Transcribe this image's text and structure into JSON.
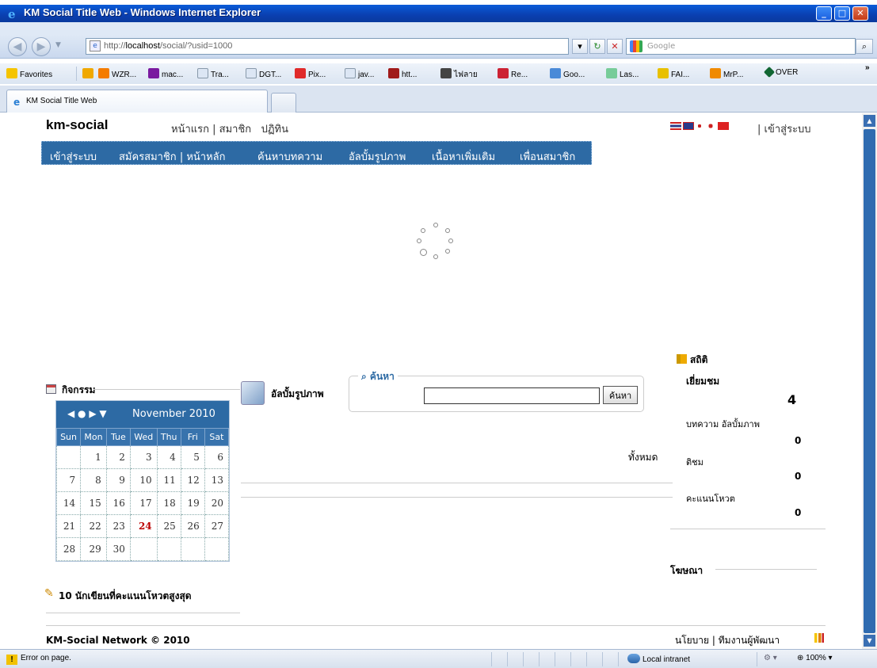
{
  "window": {
    "title": "KM Social Title Web - Windows Internet Explorer",
    "url_prefix": "http://",
    "url_host": "localhost",
    "url_path": "/social/?usid=1000",
    "search_placeholder": "Google"
  },
  "favorites": {
    "label": "Favorites",
    "items": [
      "WZR...",
      "mac...",
      "Tra...",
      "DGT...",
      "Pix...",
      "jav...",
      "htt...",
      "ไฟลาย",
      "Re...",
      "Goo...",
      "Las...",
      "FAI...",
      "MrP...",
      "OVER"
    ]
  },
  "tab": {
    "label": "KM Social Title Web"
  },
  "site": {
    "brand": "km-social",
    "top_links": [
      "หน้าแรก",
      "สมาชิก",
      "ปฏิทิน"
    ],
    "login_link": "เข้าสู่ระบบ",
    "nav": [
      "เข้าสู่ระบบ",
      "สมัครสมาชิก | หน้าหลัก",
      "ค้นหาบทความ",
      "อัลบั้มรูปภาพ",
      "เนื้อหาเพิ่มเติม",
      "เพื่อนสมาชิก"
    ]
  },
  "activities": {
    "title": "กิจกรรม"
  },
  "calendar": {
    "month_label": "November 2010",
    "nav_arrows": "◀ ● ▶ ▼",
    "weekdays": [
      "Sun",
      "Mon",
      "Tue",
      "Wed",
      "Thu",
      "Fri",
      "Sat"
    ],
    "weeks": [
      [
        "",
        "1",
        "2",
        "3",
        "4",
        "5",
        "6"
      ],
      [
        "7",
        "8",
        "9",
        "10",
        "11",
        "12",
        "13"
      ],
      [
        "14",
        "15",
        "16",
        "17",
        "18",
        "19",
        "20"
      ],
      [
        "21",
        "22",
        "23",
        "24",
        "25",
        "26",
        "27"
      ],
      [
        "28",
        "29",
        "30",
        "",
        "",
        "",
        ""
      ]
    ],
    "today": "24"
  },
  "album": {
    "title": "อัลบั้มรูปภาพ"
  },
  "search": {
    "legend": "ค้นหา",
    "button": "ค้นหา"
  },
  "all_label": "ทั้งหมด",
  "top_writers": {
    "title": "10 นักเขียนที่คะแนนโหวตสูงสุด"
  },
  "stats": {
    "title": "สถิติ",
    "visits_label": "เยี่ยมชม",
    "visits_value": "4",
    "articles_label": "บทความ อัลบั้มภาพ",
    "articles_value": "0",
    "comments_label": "ติชม",
    "comments_value": "0",
    "votes_label": "คะแนนโหวต",
    "votes_value": "0"
  },
  "ads": {
    "title": "โฆษณา"
  },
  "footer": {
    "copyright": "KM-Social Network © 2010",
    "policy": "นโยบาย",
    "dev_team": "ทีมงานผู้พัฒนา"
  },
  "status": {
    "error_text": "Error on page.",
    "zone": "Local intranet",
    "zoom": "100%"
  }
}
